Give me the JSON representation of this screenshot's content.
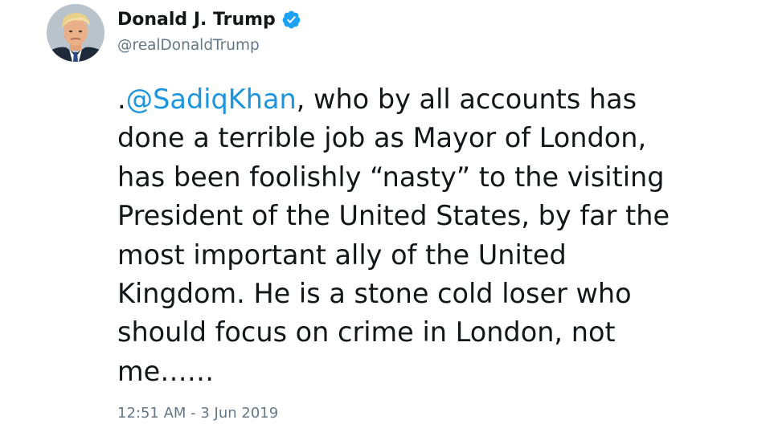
{
  "tweet": {
    "author": {
      "display_name": "Donald J. Trump",
      "handle": "@realDonaldTrump",
      "verified": true,
      "avatar_icon": "profile-photo"
    },
    "text": {
      "prefix": ".",
      "mention": "@SadiqKhan",
      "line_1_rest": ", who by all accounts has",
      "line_2": "done a terrible job as Mayor of London,",
      "line_3": "has been foolishly “nasty” to the visiting",
      "line_4": "President of the United States, by far the",
      "line_5": "most important ally of the United",
      "line_6": "Kingdom. He is a stone cold loser who",
      "line_7": "should focus on crime in London, not",
      "line_8": "me……"
    },
    "timestamp": "12:51 AM - 3 Jun 2019"
  },
  "colors": {
    "text": "#14171a",
    "secondary_text": "#657786",
    "link": "#1b95e0",
    "verified_badge": "#1da1f2"
  }
}
